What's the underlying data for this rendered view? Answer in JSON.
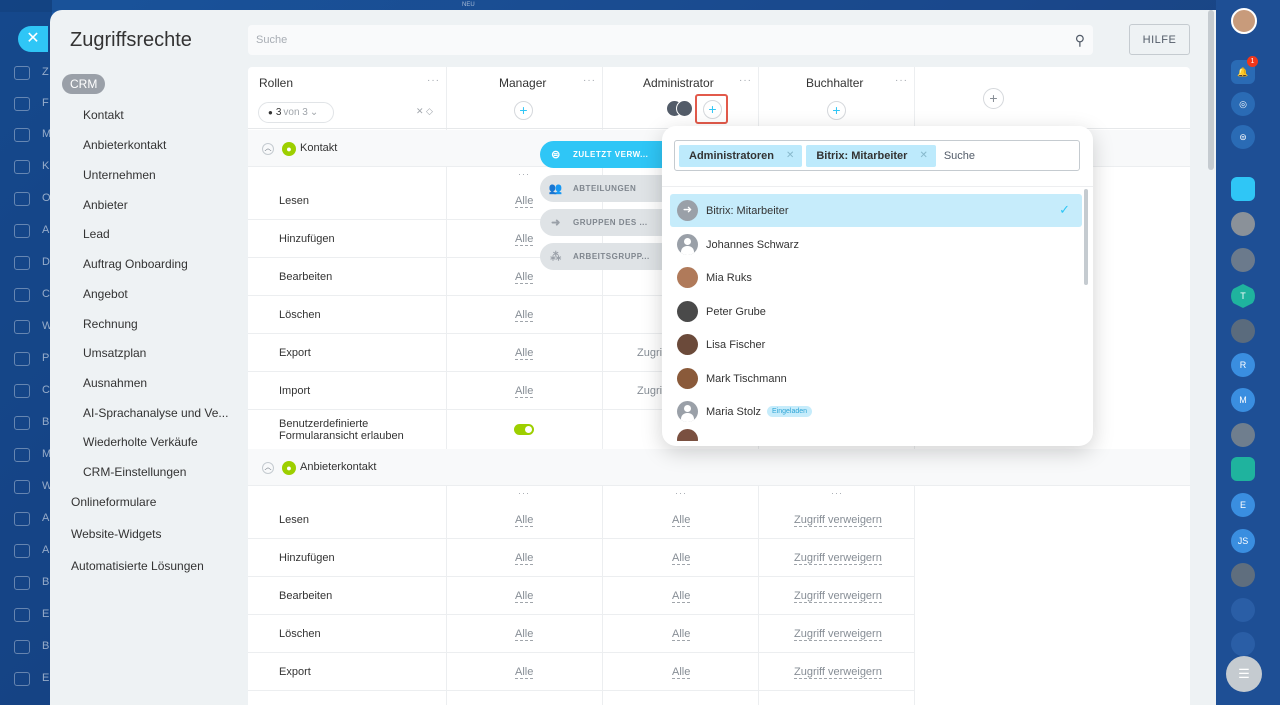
{
  "background": {
    "new_badge": "NEU",
    "left_letters": [
      "Z",
      "F",
      "M",
      "K",
      "O",
      "A",
      "D",
      "C",
      "W",
      "P",
      "C",
      "B",
      "M",
      "W",
      "A",
      "A",
      "B",
      "E",
      "B",
      "E"
    ]
  },
  "close_icon": "close-icon",
  "title": "Zugriffsrechte",
  "search_placeholder": "Suche",
  "help_label": "HILFE",
  "nav": {
    "crm_label": "CRM",
    "items": [
      "Kontakt",
      "Anbieterkontakt",
      "Unternehmen",
      "Anbieter",
      "Lead",
      "Auftrag Onboarding",
      "Angebot",
      "Rechnung",
      "Umsatzplan",
      "Ausnahmen",
      "AI-Sprachanalyse und Ve...",
      "Wiederholte Verkäufe",
      "CRM-Einstellungen"
    ],
    "top_items": [
      "Onlineformulare",
      "Website-Widgets",
      "Automatisierte Lösungen"
    ]
  },
  "table": {
    "roles_label": "Rollen",
    "counter": {
      "num": "3",
      "rest": "von 3"
    },
    "columns": [
      "Manager",
      "Administrator",
      "Buchhalter"
    ],
    "sections": [
      {
        "name": "Kontakt"
      },
      {
        "name": "Anbieterkontakt"
      }
    ],
    "rows1": [
      "Lesen",
      "Hinzufügen",
      "Bearbeiten",
      "Löschen",
      "Export",
      "Import",
      "Benutzerdefinierte Formularansicht erlauben"
    ],
    "rows1_manager": [
      "Alle",
      "Alle",
      "Alle",
      "Alle",
      "Alle",
      "Alle"
    ],
    "rows1_admin_partial": [
      "Zugri",
      "Zugri"
    ],
    "rows2": [
      "Lesen",
      "Hinzufügen",
      "Bearbeiten",
      "Löschen",
      "Export"
    ],
    "rows2_manager": [
      "Alle",
      "Alle",
      "Alle",
      "Alle",
      "Alle"
    ],
    "rows2_admin": [
      "Alle",
      "Alle",
      "Alle",
      "Alle",
      "Alle"
    ],
    "rows2_buch": [
      "Zugriff verweigern",
      "Zugriff verweigern",
      "Zugriff verweigern",
      "Zugriff verweigern",
      "Zugriff verweigern"
    ]
  },
  "tabs": [
    "ZULETZT VERW...",
    "ABTEILUNGEN",
    "GRUPPEN DES ...",
    "ARBEITSGRUPP..."
  ],
  "popup": {
    "chips": [
      "Administratoren",
      "Bitrix: Mitarbeiter"
    ],
    "search_placeholder": "Suche",
    "items": [
      {
        "name": "Bitrix: Mitarbeiter",
        "selected": true
      },
      {
        "name": "Johannes Schwarz"
      },
      {
        "name": "Mia Ruks"
      },
      {
        "name": "Peter Grube"
      },
      {
        "name": "Lisa Fischer"
      },
      {
        "name": "Mark Tischmann"
      },
      {
        "name": "Maria Stolz",
        "badge": "Eingeladen"
      }
    ]
  },
  "rightbar": {
    "notif_count": "1",
    "initials": [
      "T",
      "R",
      "M",
      "E",
      "JS"
    ]
  },
  "colors": {
    "accent": "#2fc6f6",
    "green": "#9dcf00",
    "highlight": "#e25a4b"
  }
}
